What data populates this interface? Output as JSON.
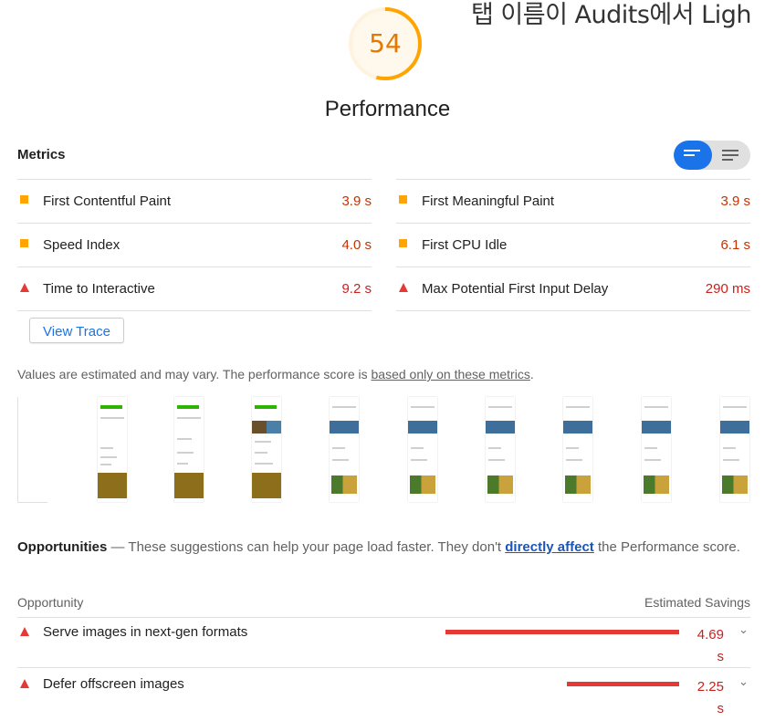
{
  "caption": "탭 이름이 Audits에서 Ligh",
  "score": {
    "value": "54",
    "fraction": 0.54,
    "label": "Performance",
    "color": "#ffa400"
  },
  "metrics": {
    "heading": "Metrics",
    "toggle": {
      "left_icon": "list-expanded-icon",
      "right_icon": "list-compact-icon"
    },
    "left": [
      {
        "label": "First Contentful Paint",
        "value": "3.9 s",
        "status": "average"
      },
      {
        "label": "Speed Index",
        "value": "4.0 s",
        "status": "average"
      },
      {
        "label": "Time to Interactive",
        "value": "9.2 s",
        "status": "fail"
      }
    ],
    "right": [
      {
        "label": "First Meaningful Paint",
        "value": "3.9 s",
        "status": "average"
      },
      {
        "label": "First CPU Idle",
        "value": "6.1 s",
        "status": "average"
      },
      {
        "label": "Max Potential First Input Delay",
        "value": "290 ms",
        "status": "fail"
      }
    ]
  },
  "view_trace": "View Trace",
  "note": {
    "prefix": "Values are estimated and may vary. The performance score is ",
    "link": "based only on these metrics",
    "suffix": "."
  },
  "opportunities": {
    "title": "Opportunities",
    "dash": " — ",
    "desc_a": "These suggestions can help your page load faster. They don't ",
    "link": "directly affect",
    "desc_b": " the Performance score.",
    "col_left": "Opportunity",
    "col_right": "Estimated Savings",
    "rows": [
      {
        "label": "Serve images in next-gen formats",
        "savings": "4.69",
        "unit": "s",
        "fraction": 1.0
      },
      {
        "label": "Defer offscreen images",
        "savings": "2.25",
        "unit": "s",
        "fraction": 0.48
      }
    ]
  },
  "colors": {
    "accent": "#1a73e8",
    "average": "#ffa400",
    "fail": "#e53935"
  }
}
